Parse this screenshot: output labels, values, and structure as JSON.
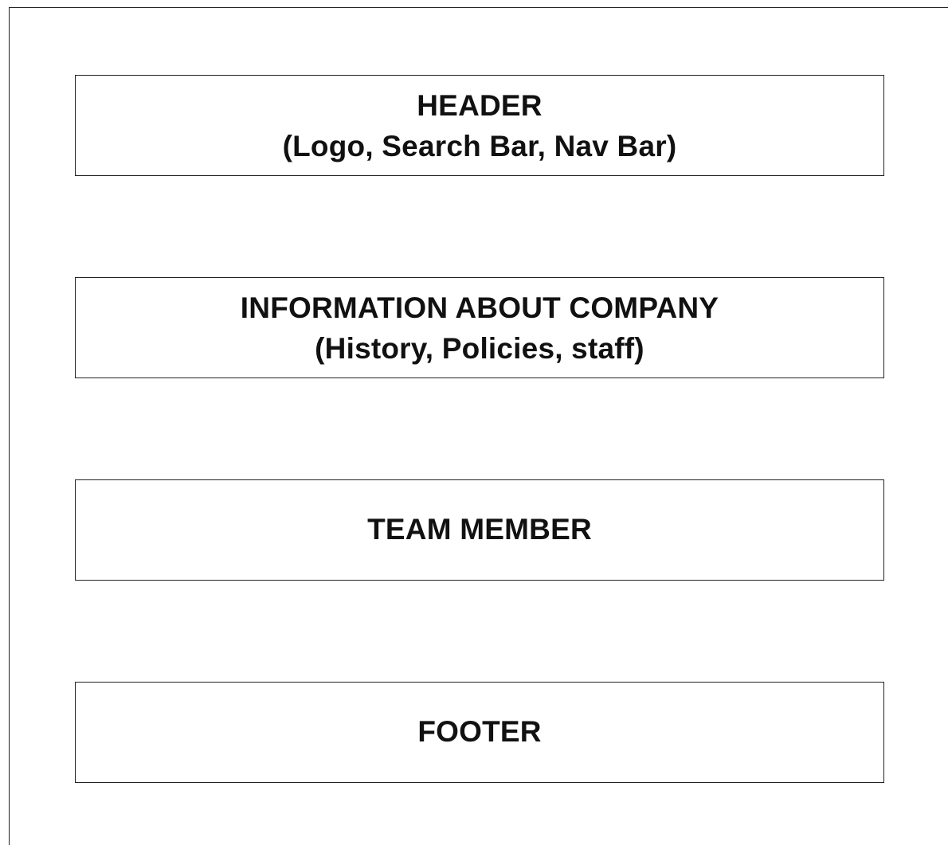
{
  "diagram": {
    "sections": [
      {
        "title": "HEADER",
        "subtitle": "(Logo, Search Bar, Nav Bar)"
      },
      {
        "title": "INFORMATION ABOUT COMPANY",
        "subtitle": "(History, Policies, staff)"
      },
      {
        "title": "TEAM MEMBER",
        "subtitle": ""
      },
      {
        "title": "FOOTER",
        "subtitle": ""
      }
    ],
    "colors": {
      "border": "#222222",
      "text": "#111111",
      "background": "#ffffff"
    }
  }
}
